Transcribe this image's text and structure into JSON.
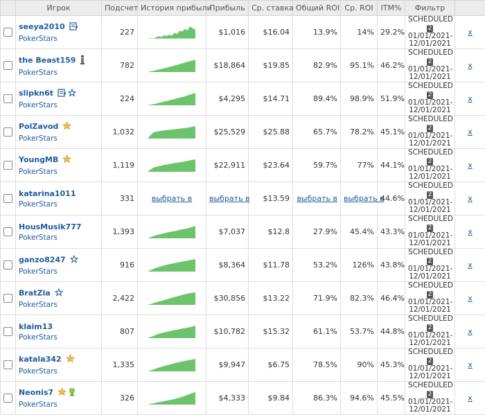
{
  "headers": [
    "Игрок",
    "Подсчет",
    "История прибыли",
    "Прибыль",
    "Ср. ставка",
    "Общий ROI",
    "Ср. ROI",
    "ITM%",
    "Фильтр"
  ],
  "colors": {
    "link": "#1f5a9c",
    "spark": "#6cc36c"
  },
  "filter": {
    "status": "SCHEDULED",
    "count": "2",
    "range_start": "01/01/2021-",
    "range_end": "12/01/2021"
  },
  "select_text": "выбрать в",
  "remove_label": "x",
  "rows": [
    {
      "name": "seeya2010",
      "network": "PokerStars",
      "count": "227",
      "profit": "$1,016",
      "avg_stake": "$16.04",
      "total_roi": "13.9%",
      "avg_roi": "14%",
      "itm": "29.2%",
      "badges": [
        "note-icon"
      ],
      "spark": [
        0.05,
        0.02,
        -0.02,
        0.1,
        0.18,
        0.12,
        0.25,
        0.2,
        0.3,
        0.22,
        0.45,
        0.35,
        0.6,
        0.55,
        0.75,
        0.62,
        0.95,
        0.8,
        0.7
      ]
    },
    {
      "name": "the Beast159",
      "network": "PokerStars",
      "count": "782",
      "profit": "$18,864",
      "avg_stake": "$19.85",
      "total_roi": "82.9%",
      "avg_roi": "95.1%",
      "itm": "46.2%",
      "badges": [
        "figure-icon"
      ],
      "spark": [
        0.02,
        0.06,
        0.1,
        0.15,
        0.2,
        0.25,
        0.3,
        0.35,
        0.4,
        0.46,
        0.52,
        0.58,
        0.64,
        0.7,
        0.76,
        0.82,
        0.88,
        0.94,
        1.0
      ]
    },
    {
      "name": "slipkn6t",
      "network": "PokerStars",
      "count": "224",
      "profit": "$4,295",
      "avg_stake": "$14.71",
      "total_roi": "89.4%",
      "avg_roi": "98.9%",
      "itm": "51.9%",
      "badges": [
        "note-icon",
        "star-outline-icon"
      ],
      "spark": [
        0.02,
        0.05,
        0.1,
        0.14,
        0.2,
        0.24,
        0.3,
        0.34,
        0.4,
        0.45,
        0.5,
        0.56,
        0.62,
        0.66,
        0.72,
        0.8,
        0.86,
        0.92,
        1.0
      ]
    },
    {
      "name": "PolZavod",
      "network": "PokerStars",
      "count": "1,032",
      "profit": "$25,529",
      "avg_stake": "$25.88",
      "total_roi": "65.7%",
      "avg_roi": "78.2%",
      "itm": "45.1%",
      "badges": [
        "star-gold-icon"
      ],
      "spark": [
        0.05,
        0.3,
        0.5,
        0.55,
        0.6,
        0.62,
        0.65,
        0.68,
        0.7,
        0.72,
        0.75,
        0.77,
        0.8,
        0.82,
        0.85,
        0.88,
        0.9,
        0.95,
        1.0
      ]
    },
    {
      "name": "YoungMB",
      "network": "PokerStars",
      "count": "1,119",
      "profit": "$22,911",
      "avg_stake": "$23.64",
      "total_roi": "59.7%",
      "avg_roi": "77%",
      "itm": "44.1%",
      "badges": [
        "star-gold-icon"
      ],
      "spark": [
        0.05,
        0.2,
        0.35,
        0.4,
        0.45,
        0.5,
        0.55,
        0.58,
        0.62,
        0.66,
        0.7,
        0.72,
        0.76,
        0.8,
        0.84,
        0.88,
        0.92,
        0.96,
        1.0
      ]
    },
    {
      "name": "katarina1011",
      "network": "PokerStars",
      "count": "331",
      "profit": "",
      "avg_stake": "$13.59",
      "total_roi": "",
      "avg_roi": "",
      "itm": "44.6%",
      "badges": [],
      "spark": null,
      "placeholder": true
    },
    {
      "name": "HousMusik777",
      "network": "PokerStars",
      "count": "1,393",
      "profit": "$7,037",
      "avg_stake": "$12.8",
      "total_roi": "27.9%",
      "avg_roi": "45.4%",
      "itm": "43.3%",
      "badges": [],
      "spark": [
        0.02,
        0.1,
        0.18,
        0.25,
        0.3,
        0.35,
        0.4,
        0.45,
        0.5,
        0.55,
        0.58,
        0.62,
        0.68,
        0.72,
        0.76,
        0.8,
        0.86,
        0.92,
        1.0
      ]
    },
    {
      "name": "ganzo8247",
      "network": "PokerStars",
      "count": "916",
      "profit": "$8,364",
      "avg_stake": "$11.78",
      "total_roi": "53.2%",
      "avg_roi": "126%",
      "itm": "43.8%",
      "badges": [
        "star-outline-icon"
      ],
      "spark": [
        0.02,
        0.12,
        0.22,
        0.3,
        0.36,
        0.42,
        0.48,
        0.54,
        0.6,
        0.64,
        0.68,
        0.72,
        0.76,
        0.8,
        0.84,
        0.88,
        0.92,
        0.96,
        1.0
      ]
    },
    {
      "name": "BratZla",
      "network": "PokerStars",
      "count": "2,422",
      "profit": "$30,856",
      "avg_stake": "$13.22",
      "total_roi": "71.9%",
      "avg_roi": "82.3%",
      "itm": "46.4%",
      "badges": [
        "star-outline-icon"
      ],
      "spark": [
        0.02,
        0.08,
        0.14,
        0.2,
        0.26,
        0.32,
        0.38,
        0.44,
        0.5,
        0.56,
        0.62,
        0.68,
        0.74,
        0.8,
        0.86,
        0.9,
        0.94,
        0.97,
        1.0
      ]
    },
    {
      "name": "klaim13",
      "network": "PokerStars",
      "count": "807",
      "profit": "$10,782",
      "avg_stake": "$15.32",
      "total_roi": "61.1%",
      "avg_roi": "53.7%",
      "itm": "44.8%",
      "badges": [],
      "spark": [
        0.02,
        0.1,
        0.18,
        0.26,
        0.34,
        0.4,
        0.45,
        0.5,
        0.55,
        0.6,
        0.64,
        0.68,
        0.72,
        0.76,
        0.8,
        0.84,
        0.88,
        0.94,
        1.0
      ]
    },
    {
      "name": "katala342",
      "network": "PokerStars",
      "count": "1,335",
      "profit": "$9,947",
      "avg_stake": "$6.75",
      "total_roi": "78.5%",
      "avg_roi": "90%",
      "itm": "45.3%",
      "badges": [
        "star-gold-icon"
      ],
      "spark": [
        0.02,
        0.08,
        0.15,
        0.22,
        0.3,
        0.36,
        0.42,
        0.48,
        0.54,
        0.6,
        0.66,
        0.7,
        0.75,
        0.8,
        0.85,
        0.88,
        0.92,
        0.96,
        1.0
      ]
    },
    {
      "name": "Neonis7",
      "network": "PokerStars",
      "count": "326",
      "profit": "$4,333",
      "avg_stake": "$9.84",
      "total_roi": "86.3%",
      "avg_roi": "94.6%",
      "itm": "45.5%",
      "badges": [
        "star-gold-icon",
        "trophy-icon"
      ],
      "spark": [
        0.02,
        0.06,
        0.1,
        0.15,
        0.2,
        0.24,
        0.28,
        0.32,
        0.36,
        0.4,
        0.45,
        0.5,
        0.56,
        0.62,
        0.7,
        0.78,
        0.86,
        0.94,
        1.0
      ]
    }
  ]
}
